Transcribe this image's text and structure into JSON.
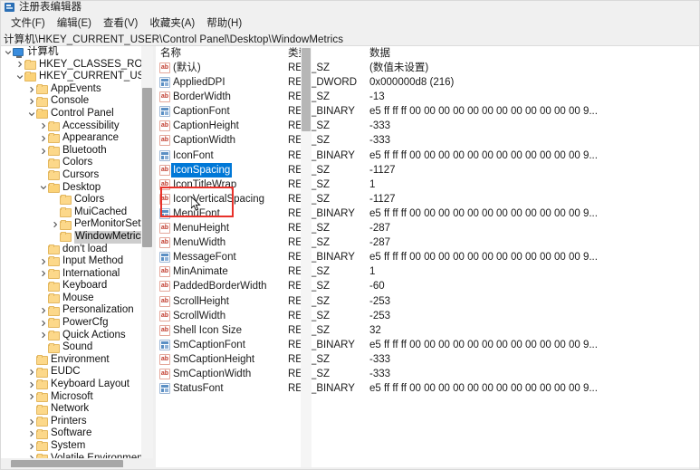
{
  "window": {
    "title": "注册表编辑器",
    "icon": "registry-editor-icon"
  },
  "menubar": {
    "items": [
      {
        "label": "文件(F)",
        "name": "menu-file"
      },
      {
        "label": "编辑(E)",
        "name": "menu-edit"
      },
      {
        "label": "查看(V)",
        "name": "menu-view"
      },
      {
        "label": "收藏夹(A)",
        "name": "menu-favorites"
      },
      {
        "label": "帮助(H)",
        "name": "menu-help"
      }
    ]
  },
  "address": {
    "path": "计算机\\HKEY_CURRENT_USER\\Control Panel\\Desktop\\WindowMetrics"
  },
  "tree": {
    "nodes": [
      {
        "label": "计算机",
        "depth": 0,
        "twisty": "down",
        "icon": "computer-icon",
        "selected": false
      },
      {
        "label": "HKEY_CLASSES_ROOT",
        "depth": 1,
        "twisty": "right",
        "icon": "folder-icon",
        "selected": false
      },
      {
        "label": "HKEY_CURRENT_USER",
        "depth": 1,
        "twisty": "down",
        "icon": "folder-icon",
        "selected": false
      },
      {
        "label": "AppEvents",
        "depth": 2,
        "twisty": "right",
        "icon": "folder-icon",
        "selected": false
      },
      {
        "label": "Console",
        "depth": 2,
        "twisty": "right",
        "icon": "folder-icon",
        "selected": false
      },
      {
        "label": "Control Panel",
        "depth": 2,
        "twisty": "down",
        "icon": "folder-icon",
        "selected": false
      },
      {
        "label": "Accessibility",
        "depth": 3,
        "twisty": "right",
        "icon": "folder-icon",
        "selected": false
      },
      {
        "label": "Appearance",
        "depth": 3,
        "twisty": "right",
        "icon": "folder-icon",
        "selected": false
      },
      {
        "label": "Bluetooth",
        "depth": 3,
        "twisty": "right",
        "icon": "folder-icon",
        "selected": false
      },
      {
        "label": "Colors",
        "depth": 3,
        "twisty": "none",
        "icon": "folder-icon",
        "selected": false
      },
      {
        "label": "Cursors",
        "depth": 3,
        "twisty": "none",
        "icon": "folder-icon",
        "selected": false
      },
      {
        "label": "Desktop",
        "depth": 3,
        "twisty": "down",
        "icon": "folder-icon",
        "selected": false
      },
      {
        "label": "Colors",
        "depth": 4,
        "twisty": "none",
        "icon": "folder-icon",
        "selected": false
      },
      {
        "label": "MuiCached",
        "depth": 4,
        "twisty": "none",
        "icon": "folder-icon",
        "selected": false
      },
      {
        "label": "PerMonitorSettin",
        "depth": 4,
        "twisty": "right",
        "icon": "folder-icon",
        "selected": false
      },
      {
        "label": "WindowMetrics",
        "depth": 4,
        "twisty": "none",
        "icon": "folder-icon",
        "selected": true
      },
      {
        "label": "don't load",
        "depth": 3,
        "twisty": "none",
        "icon": "folder-icon",
        "selected": false
      },
      {
        "label": "Input Method",
        "depth": 3,
        "twisty": "right",
        "icon": "folder-icon",
        "selected": false
      },
      {
        "label": "International",
        "depth": 3,
        "twisty": "right",
        "icon": "folder-icon",
        "selected": false
      },
      {
        "label": "Keyboard",
        "depth": 3,
        "twisty": "none",
        "icon": "folder-icon",
        "selected": false
      },
      {
        "label": "Mouse",
        "depth": 3,
        "twisty": "none",
        "icon": "folder-icon",
        "selected": false
      },
      {
        "label": "Personalization",
        "depth": 3,
        "twisty": "right",
        "icon": "folder-icon",
        "selected": false
      },
      {
        "label": "PowerCfg",
        "depth": 3,
        "twisty": "right",
        "icon": "folder-icon",
        "selected": false
      },
      {
        "label": "Quick Actions",
        "depth": 3,
        "twisty": "right",
        "icon": "folder-icon",
        "selected": false
      },
      {
        "label": "Sound",
        "depth": 3,
        "twisty": "none",
        "icon": "folder-icon",
        "selected": false
      },
      {
        "label": "Environment",
        "depth": 2,
        "twisty": "none",
        "icon": "folder-icon",
        "selected": false
      },
      {
        "label": "EUDC",
        "depth": 2,
        "twisty": "right",
        "icon": "folder-icon",
        "selected": false
      },
      {
        "label": "Keyboard Layout",
        "depth": 2,
        "twisty": "right",
        "icon": "folder-icon",
        "selected": false
      },
      {
        "label": "Microsoft",
        "depth": 2,
        "twisty": "right",
        "icon": "folder-icon",
        "selected": false
      },
      {
        "label": "Network",
        "depth": 2,
        "twisty": "none",
        "icon": "folder-icon",
        "selected": false
      },
      {
        "label": "Printers",
        "depth": 2,
        "twisty": "right",
        "icon": "folder-icon",
        "selected": false
      },
      {
        "label": "Software",
        "depth": 2,
        "twisty": "right",
        "icon": "folder-icon",
        "selected": false
      },
      {
        "label": "System",
        "depth": 2,
        "twisty": "right",
        "icon": "folder-icon",
        "selected": false
      },
      {
        "label": "Volatile Environment",
        "depth": 2,
        "twisty": "right",
        "icon": "folder-icon",
        "selected": false
      }
    ]
  },
  "list": {
    "columns": [
      "名称",
      "类型",
      "数据"
    ],
    "rows": [
      {
        "name": "(默认)",
        "type": "REG_SZ",
        "data": "(数值未设置)",
        "icon": "string-value-icon",
        "selected": false
      },
      {
        "name": "AppliedDPI",
        "type": "REG_DWORD",
        "data": "0x000000d8 (216)",
        "icon": "binary-value-icon",
        "selected": false
      },
      {
        "name": "BorderWidth",
        "type": "REG_SZ",
        "data": "-13",
        "icon": "string-value-icon",
        "selected": false
      },
      {
        "name": "CaptionFont",
        "type": "REG_BINARY",
        "data": "e5 ff ff ff 00 00 00 00 00 00 00 00 00 00 00 00 9...",
        "icon": "binary-value-icon",
        "selected": false
      },
      {
        "name": "CaptionHeight",
        "type": "REG_SZ",
        "data": "-333",
        "icon": "string-value-icon",
        "selected": false
      },
      {
        "name": "CaptionWidth",
        "type": "REG_SZ",
        "data": "-333",
        "icon": "string-value-icon",
        "selected": false
      },
      {
        "name": "IconFont",
        "type": "REG_BINARY",
        "data": "e5 ff ff ff 00 00 00 00 00 00 00 00 00 00 00 00 9...",
        "icon": "binary-value-icon",
        "selected": false
      },
      {
        "name": "IconSpacing",
        "type": "REG_SZ",
        "data": "-1127",
        "icon": "string-value-icon",
        "selected": true
      },
      {
        "name": "IconTitleWrap",
        "type": "REG_SZ",
        "data": "1",
        "icon": "string-value-icon",
        "selected": false
      },
      {
        "name": "IconVerticalSpacing",
        "type": "REG_SZ",
        "data": "-1127",
        "icon": "string-value-icon",
        "selected": false
      },
      {
        "name": "MenuFont",
        "type": "REG_BINARY",
        "data": "e5 ff ff ff 00 00 00 00 00 00 00 00 00 00 00 00 9...",
        "icon": "binary-value-icon",
        "selected": false
      },
      {
        "name": "MenuHeight",
        "type": "REG_SZ",
        "data": "-287",
        "icon": "string-value-icon",
        "selected": false
      },
      {
        "name": "MenuWidth",
        "type": "REG_SZ",
        "data": "-287",
        "icon": "string-value-icon",
        "selected": false
      },
      {
        "name": "MessageFont",
        "type": "REG_BINARY",
        "data": "e5 ff ff ff 00 00 00 00 00 00 00 00 00 00 00 00 9...",
        "icon": "binary-value-icon",
        "selected": false
      },
      {
        "name": "MinAnimate",
        "type": "REG_SZ",
        "data": "1",
        "icon": "string-value-icon",
        "selected": false
      },
      {
        "name": "PaddedBorderWidth",
        "type": "REG_SZ",
        "data": "-60",
        "icon": "string-value-icon",
        "selected": false
      },
      {
        "name": "ScrollHeight",
        "type": "REG_SZ",
        "data": "-253",
        "icon": "string-value-icon",
        "selected": false
      },
      {
        "name": "ScrollWidth",
        "type": "REG_SZ",
        "data": "-253",
        "icon": "string-value-icon",
        "selected": false
      },
      {
        "name": "Shell Icon Size",
        "type": "REG_SZ",
        "data": "32",
        "icon": "string-value-icon",
        "selected": false
      },
      {
        "name": "SmCaptionFont",
        "type": "REG_BINARY",
        "data": "e5 ff ff ff 00 00 00 00 00 00 00 00 00 00 00 00 9...",
        "icon": "binary-value-icon",
        "selected": false
      },
      {
        "name": "SmCaptionHeight",
        "type": "REG_SZ",
        "data": "-333",
        "icon": "string-value-icon",
        "selected": false
      },
      {
        "name": "SmCaptionWidth",
        "type": "REG_SZ",
        "data": "-333",
        "icon": "string-value-icon",
        "selected": false
      },
      {
        "name": "StatusFont",
        "type": "REG_BINARY",
        "data": "e5 ff ff ff 00 00 00 00 00 00 00 00 00 00 00 00 9...",
        "icon": "binary-value-icon",
        "selected": false
      }
    ]
  },
  "annotation": {
    "highlight_color": "#e8312a",
    "selection_color": "#0078d7"
  },
  "icons": {
    "string_value_text": "ab"
  }
}
